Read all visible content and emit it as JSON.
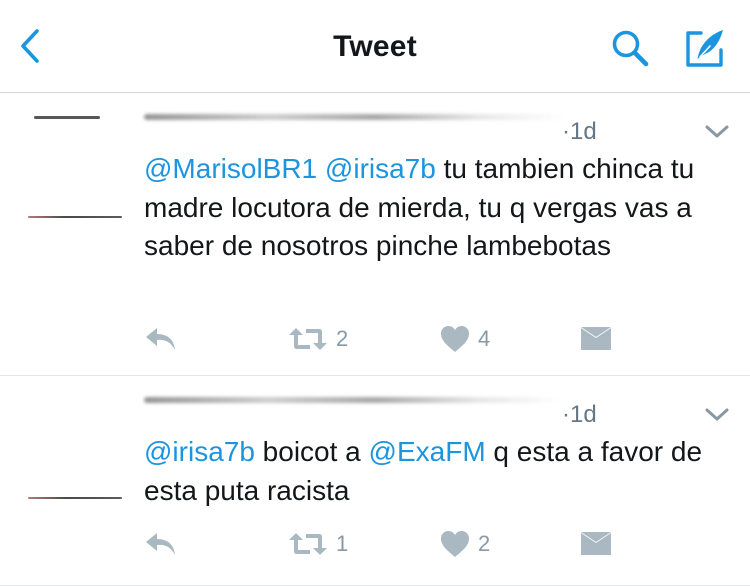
{
  "nav": {
    "title": "Tweet",
    "back_icon": "chevron-left-icon",
    "search_icon": "search-icon",
    "compose_icon": "compose-icon",
    "accent": "#1b95e0"
  },
  "tweets": [
    {
      "time": "·1d",
      "segments": [
        {
          "text": "@MarisolBR1",
          "mention": true
        },
        {
          "text": " ",
          "mention": false
        },
        {
          "text": "@irisa7b",
          "mention": true
        },
        {
          "text": " tu tambien chinca tu madre locutora de mierda, tu q vergas vas a saber de nosotros pinche lambebotas",
          "mention": false
        }
      ],
      "retweets": "2",
      "likes": "4"
    },
    {
      "time": "·1d",
      "segments": [
        {
          "text": "@irisa7b",
          "mention": true
        },
        {
          "text": " boicot a ",
          "mention": false
        },
        {
          "text": "@ExaFM",
          "mention": true
        },
        {
          "text": " q esta a favor de esta puta racista",
          "mention": false
        }
      ],
      "retweets": "1",
      "likes": "2"
    }
  ]
}
